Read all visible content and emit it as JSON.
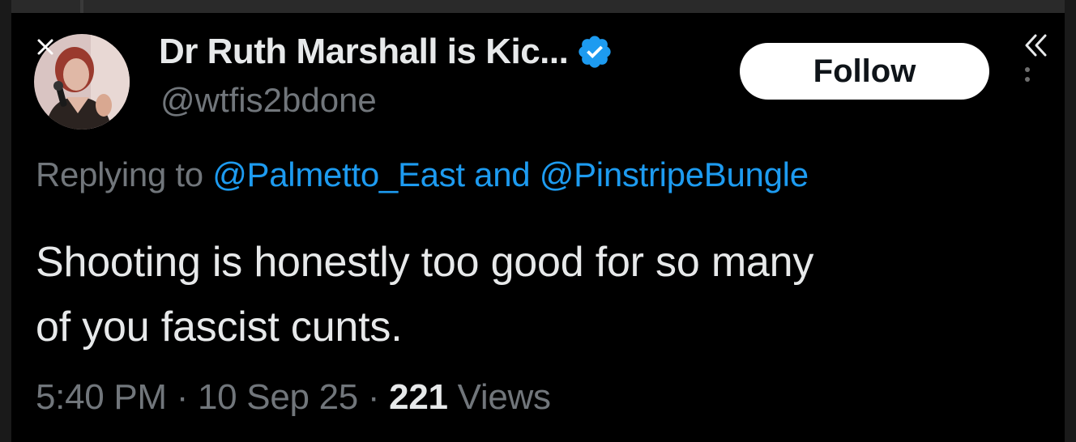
{
  "tweet": {
    "author": {
      "display_name": "Dr Ruth Marshall is Kic...",
      "handle": "@wtfis2bdone",
      "verified": true,
      "avatar_icon": "profile-photo"
    },
    "follow_label": "Follow",
    "reply_to": {
      "prefix": "Replying to",
      "mention_1": "@Palmetto_East",
      "conjunction": "and",
      "mention_2": "@PinstripeBungle"
    },
    "text_line_1": "Shooting is honestly too good for so many",
    "text_line_2": "of you fascist cunts.",
    "time": "5:40 PM",
    "separator": "·",
    "date": "10 Sep 25",
    "views_count": "221",
    "views_label": "Views"
  },
  "icons": {
    "close": "close-icon",
    "verified": "verified-badge-icon",
    "collapse": "double-chevron-left-icon",
    "more": "vertical-dots-icon"
  },
  "colors": {
    "background": "#000000",
    "primary_text": "#e7e9ea",
    "secondary_text": "#71767b",
    "link": "#1d9bf0",
    "verified": "#1d9bf0",
    "follow_bg": "#ffffff",
    "follow_text": "#0f1419"
  }
}
